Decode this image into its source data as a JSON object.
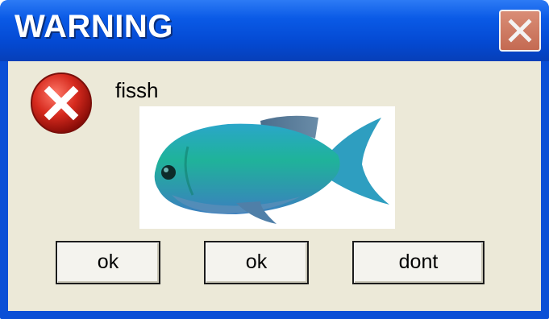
{
  "dialog": {
    "title": "WARNING",
    "message": "fissh",
    "buttons": [
      {
        "label": "ok"
      },
      {
        "label": "ok"
      },
      {
        "label": "dont"
      }
    ],
    "icons": {
      "close": "close-icon",
      "error": "error-icon",
      "image": "fish-image"
    }
  },
  "colors": {
    "titlebar": "#0a5ae6",
    "client_bg": "#ece9d8",
    "close_button": "#d98d76",
    "error_red": "#d62a1e",
    "fish": "#1fb39a"
  }
}
